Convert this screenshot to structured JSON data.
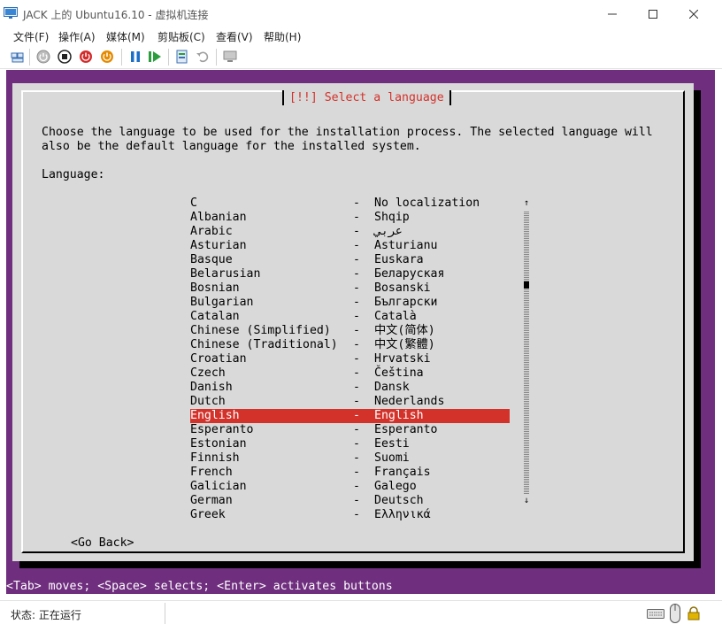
{
  "window": {
    "title": "JACK 上的 Ubuntu16.10 - 虚拟机连接",
    "app_icon": "vm-monitor-icon",
    "controls": {
      "minimize": "—",
      "maximize": "☐",
      "close": "✕"
    }
  },
  "menu": [
    "文件(F)",
    "操作(A)",
    "媒体(M)",
    "剪贴板(C)",
    "查看(V)",
    "帮助(H)"
  ],
  "toolbar": {
    "icons": [
      "ctrl-alt-del-icon",
      "start-icon",
      "turn-off-icon",
      "shutdown-icon",
      "save-icon",
      "pause-icon",
      "resume-icon",
      "checkpoint-icon",
      "revert-icon",
      "enhanced-session-icon"
    ],
    "colors": {
      "shutdown": "#d42b2b",
      "save": "#e68a00",
      "pause": "#1a6fc9",
      "resume": "#2a9d3c"
    }
  },
  "installer": {
    "dialog_title": "[!!] Select a language",
    "description_line1": "Choose the language to be used for the installation process. The selected language will",
    "description_line2": "also be the default language for the installed system.",
    "language_label": "Language:",
    "languages": [
      {
        "name": "C",
        "sep": "-",
        "native": "No localization"
      },
      {
        "name": "Albanian",
        "sep": "-",
        "native": "Shqip"
      },
      {
        "name": "Arabic",
        "sep": "-",
        "native": "عربي"
      },
      {
        "name": "Asturian",
        "sep": "-",
        "native": "Asturianu"
      },
      {
        "name": "Basque",
        "sep": "-",
        "native": "Euskara"
      },
      {
        "name": "Belarusian",
        "sep": "-",
        "native": "Беларуская"
      },
      {
        "name": "Bosnian",
        "sep": "-",
        "native": "Bosanski"
      },
      {
        "name": "Bulgarian",
        "sep": "-",
        "native": "Български"
      },
      {
        "name": "Catalan",
        "sep": "-",
        "native": "Català"
      },
      {
        "name": "Chinese (Simplified)",
        "sep": "-",
        "native": "中文(简体)"
      },
      {
        "name": "Chinese (Traditional)",
        "sep": "-",
        "native": "中文(繁體)"
      },
      {
        "name": "Croatian",
        "sep": "-",
        "native": "Hrvatski"
      },
      {
        "name": "Czech",
        "sep": "-",
        "native": "Čeština"
      },
      {
        "name": "Danish",
        "sep": "-",
        "native": "Dansk"
      },
      {
        "name": "Dutch",
        "sep": "-",
        "native": "Nederlands"
      },
      {
        "name": "English",
        "sep": "-",
        "native": "English"
      },
      {
        "name": "Esperanto",
        "sep": "-",
        "native": "Esperanto"
      },
      {
        "name": "Estonian",
        "sep": "-",
        "native": "Eesti"
      },
      {
        "name": "Finnish",
        "sep": "-",
        "native": "Suomi"
      },
      {
        "name": "French",
        "sep": "-",
        "native": "Français"
      },
      {
        "name": "Galician",
        "sep": "-",
        "native": "Galego"
      },
      {
        "name": "German",
        "sep": "-",
        "native": "Deutsch"
      },
      {
        "name": "Greek",
        "sep": "-",
        "native": "Ελληνικά"
      }
    ],
    "selected": "English",
    "scroll_up": "↑",
    "scroll_down": "↓",
    "go_back": "<Go Back>",
    "help_line": "<Tab> moves; <Space> selects; <Enter> activates buttons",
    "colors": {
      "background": "#6f2e7e",
      "dialog": "#d9d9d9",
      "accent": "#d3322b",
      "help_text": "#ffffff"
    }
  },
  "status": {
    "label": "状态: 正在运行",
    "icons": [
      "keyboard-icon",
      "mouse-icon",
      "lock-icon"
    ]
  }
}
